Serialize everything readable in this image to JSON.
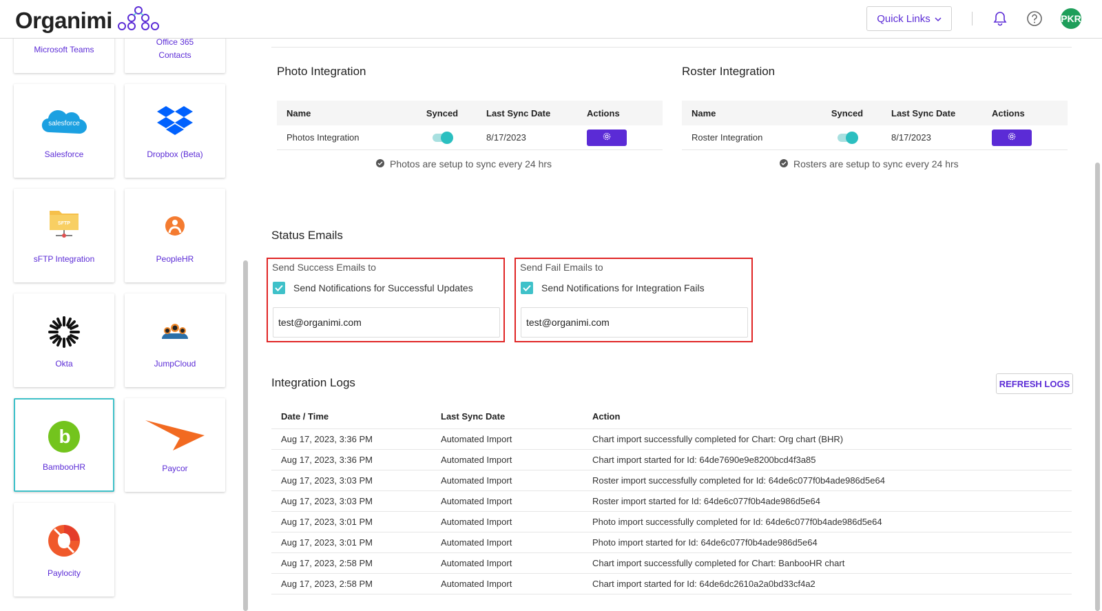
{
  "header": {
    "logo_text": "Organimi",
    "quick_links_label": "Quick Links",
    "avatar_initials": "PKR"
  },
  "sidebar": {
    "cards": [
      {
        "label": "Microsoft Teams",
        "icon": "microsoft-teams-icon"
      },
      {
        "label": "Office 365 Contacts",
        "icon": "office-365-icon"
      },
      {
        "label": "Salesforce",
        "icon": "salesforce-icon",
        "icon_text": "salesforce"
      },
      {
        "label": "Dropbox (Beta)",
        "icon": "dropbox-icon"
      },
      {
        "label": "sFTP Integration",
        "icon": "sftp-folder-icon",
        "icon_text": "SFTP"
      },
      {
        "label": "PeopleHR",
        "icon": "peoplehr-icon"
      },
      {
        "label": "Okta",
        "icon": "okta-icon"
      },
      {
        "label": "JumpCloud",
        "icon": "jumpcloud-icon"
      },
      {
        "label": "BambooHR",
        "icon": "bamboohr-icon",
        "icon_text": "b",
        "selected": true
      },
      {
        "label": "Paycor",
        "icon": "paycor-icon"
      },
      {
        "label": "Paylocity",
        "icon": "paylocity-icon"
      }
    ]
  },
  "photo": {
    "title": "Photo Integration",
    "columns": [
      "Name",
      "Synced",
      "Last Sync Date",
      "Actions"
    ],
    "row": {
      "name": "Photos Integration",
      "synced": true,
      "last_sync": "8/17/2023"
    },
    "note": "Photos are setup to sync every 24 hrs"
  },
  "roster": {
    "title": "Roster Integration",
    "columns": [
      "Name",
      "Synced",
      "Last Sync Date",
      "Actions"
    ],
    "row": {
      "name": "Roster Integration",
      "synced": true,
      "last_sync": "8/17/2023"
    },
    "note": "Rosters are setup to sync every 24 hrs"
  },
  "status_emails": {
    "title": "Status Emails",
    "success": {
      "caption": "Send Success Emails to",
      "checkbox_label": "Send Notifications for Successful Updates",
      "checked": true,
      "email": "test@organimi.com"
    },
    "fail": {
      "caption": "Send Fail Emails to",
      "checkbox_label": "Send Notifications for Integration Fails",
      "checked": true,
      "email": "test@organimi.com"
    }
  },
  "logs": {
    "title": "Integration Logs",
    "refresh_label": "REFRESH LOGS",
    "columns": [
      "Date / Time",
      "Last Sync Date",
      "Action"
    ],
    "rows": [
      {
        "date": "Aug 17, 2023, 3:36 PM",
        "type": "Automated Import",
        "action": "Chart import successfully completed for Chart: Org chart (BHR)"
      },
      {
        "date": "Aug 17, 2023, 3:36 PM",
        "type": "Automated Import",
        "action": "Chart import started for Id: 64de7690e9e8200bcd4f3a85"
      },
      {
        "date": "Aug 17, 2023, 3:03 PM",
        "type": "Automated Import",
        "action": "Roster import successfully completed for Id: 64de6c077f0b4ade986d5e64"
      },
      {
        "date": "Aug 17, 2023, 3:03 PM",
        "type": "Automated Import",
        "action": "Roster import started for Id: 64de6c077f0b4ade986d5e64"
      },
      {
        "date": "Aug 17, 2023, 3:01 PM",
        "type": "Automated Import",
        "action": "Photo import successfully completed for Id: 64de6c077f0b4ade986d5e64"
      },
      {
        "date": "Aug 17, 2023, 3:01 PM",
        "type": "Automated Import",
        "action": "Photo import started for Id: 64de6c077f0b4ade986d5e64"
      },
      {
        "date": "Aug 17, 2023, 2:58 PM",
        "type": "Automated Import",
        "action": "Chart import successfully completed for Chart: BanbooHR chart"
      },
      {
        "date": "Aug 17, 2023, 2:58 PM",
        "type": "Automated Import",
        "action": "Chart import started for Id: 64de6dc2610a2a0bd33cf4a2"
      }
    ]
  },
  "colors": {
    "accent": "#5b2bd6",
    "teal": "#3fc1c9",
    "highlight": "#e02424"
  }
}
